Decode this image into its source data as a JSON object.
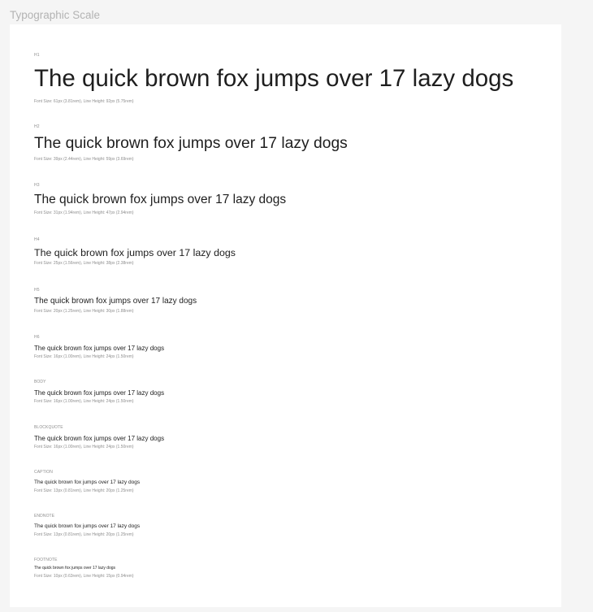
{
  "frame_title": "Typographic Scale",
  "sample_text": "The quick brown fox jumps over 17 lazy dogs",
  "styles": [
    {
      "label": "H1",
      "sample": "The quick brown fox jumps over 17 lazy dogs",
      "spec": "Font Size: 61px (3.81rem), Line Height: 92px (5.75rem)"
    },
    {
      "label": "H2",
      "sample": "The quick brown fox jumps over 17 lazy dogs",
      "spec": "Font Size: 39px (2.44rem), Line Height: 59px (3.69rem)"
    },
    {
      "label": "H3",
      "sample": "The quick brown fox jumps over 17 lazy dogs",
      "spec": "Font Size: 31px (1.94rem), Line Height: 47px (2.94rem)"
    },
    {
      "label": "H4",
      "sample": "The quick brown fox jumps over 17 lazy dogs",
      "spec": "Font Size: 25px (1.56rem), Line Height: 38px (2.38rem)"
    },
    {
      "label": "H5",
      "sample": "The quick brown fox jumps over 17 lazy dogs",
      "spec": "Font Size: 20px (1.25rem), Line Height: 30px (1.88rem)"
    },
    {
      "label": "H6",
      "sample": "The quick brown fox jumps over 17 lazy dogs",
      "spec": "Font Size: 16px (1.00rem), Line Height: 24px (1.50rem)"
    },
    {
      "label": "BODY",
      "sample": "The quick brown fox jumps over 17 lazy dogs",
      "spec": "Font Size: 16px (1.00rem), Line Height: 24px (1.50rem)"
    },
    {
      "label": "BLOCKQUOTE",
      "sample": "The quick brown fox jumps over 17 lazy dogs",
      "spec": "Font Size: 16px (1.00rem), Line Height: 24px (1.50rem)"
    },
    {
      "label": "CAPTION",
      "sample": "The quick brown fox jumps over 17 lazy dogs",
      "spec": "Font Size: 13px (0.81rem), Line Height: 20px (1.25rem)"
    },
    {
      "label": "ENDNOTE",
      "sample": "The quick brown fox jumps over 17 lazy dogs",
      "spec": "Font Size: 13px (0.81rem), Line Height: 20px (1.25rem)"
    },
    {
      "label": "FOOTNOTE",
      "sample": "The quick brown fox jumps over 17 lazy dogs",
      "spec": "Font Size: 10px (0.63rem), Line Height: 15px (0.94rem)"
    }
  ]
}
